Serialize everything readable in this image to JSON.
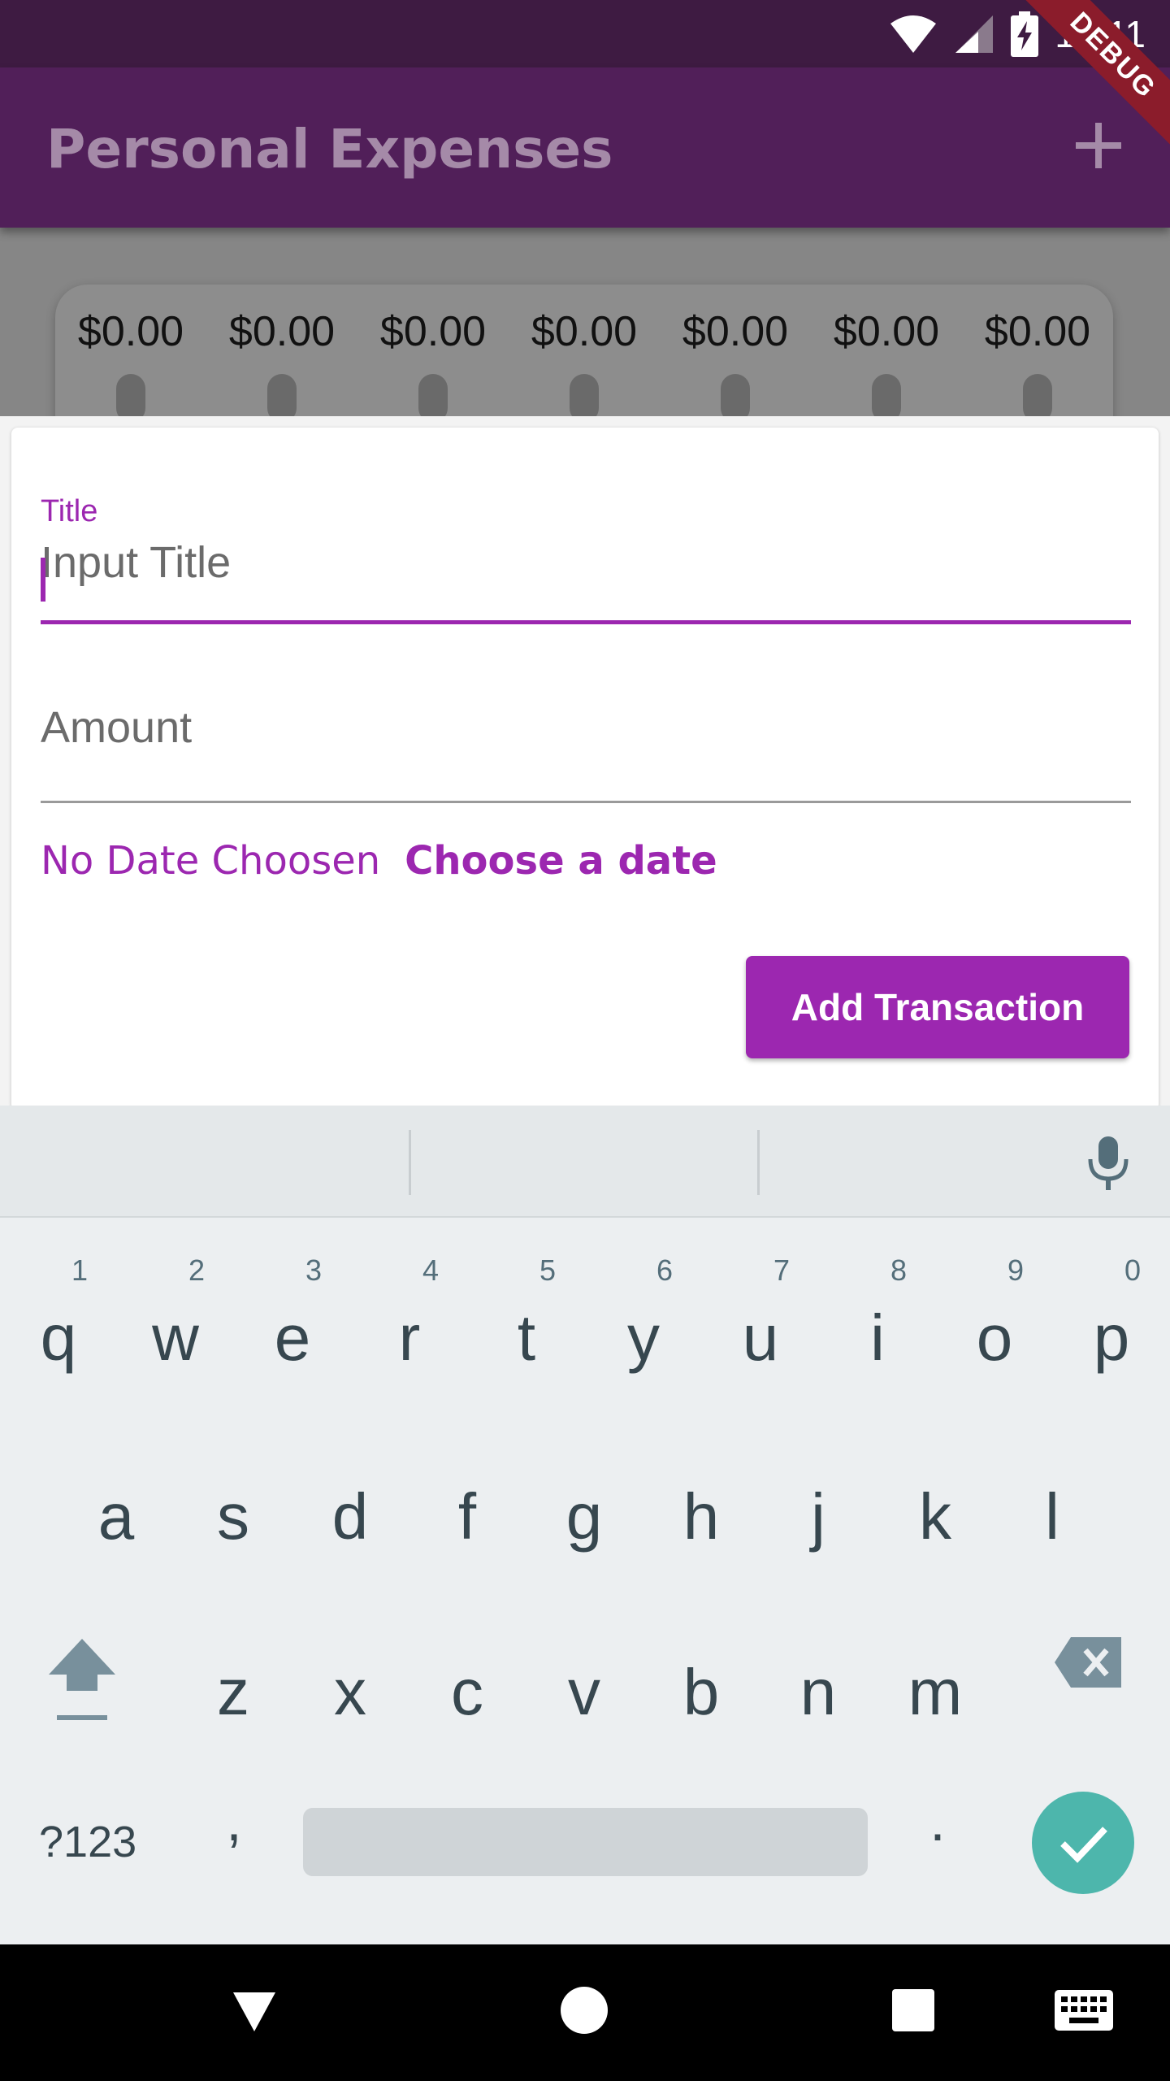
{
  "status_bar": {
    "time": "10:11",
    "debug_label": "DEBUG"
  },
  "app_bar": {
    "title": "Personal Expenses",
    "add_icon": "plus-icon"
  },
  "chart_data": {
    "type": "bar",
    "categories": [],
    "values": [
      0,
      0,
      0,
      0,
      0,
      0,
      0
    ],
    "labels": [
      "$0.00",
      "$0.00",
      "$0.00",
      "$0.00",
      "$0.00",
      "$0.00",
      "$0.00"
    ]
  },
  "form": {
    "title_label": "Title",
    "title_placeholder": "Input Title",
    "title_value": "",
    "amount_placeholder": "Amount",
    "amount_value": "",
    "date_text": "No Date Choosen",
    "choose_date": "Choose a date",
    "submit": "Add Transaction"
  },
  "colors": {
    "accent": "#9c27b0",
    "appbar": "#511f59",
    "status": "#3e1b42",
    "enter": "#4db6ac"
  },
  "keyboard": {
    "row1": [
      "q",
      "w",
      "e",
      "r",
      "t",
      "y",
      "u",
      "i",
      "o",
      "p"
    ],
    "row1_hints": [
      "1",
      "2",
      "3",
      "4",
      "5",
      "6",
      "7",
      "8",
      "9",
      "0"
    ],
    "row2": [
      "a",
      "s",
      "d",
      "f",
      "g",
      "h",
      "j",
      "k",
      "l"
    ],
    "row3": [
      "z",
      "x",
      "c",
      "v",
      "b",
      "n",
      "m"
    ],
    "symbols": "?123",
    "comma": ",",
    "period": "."
  }
}
